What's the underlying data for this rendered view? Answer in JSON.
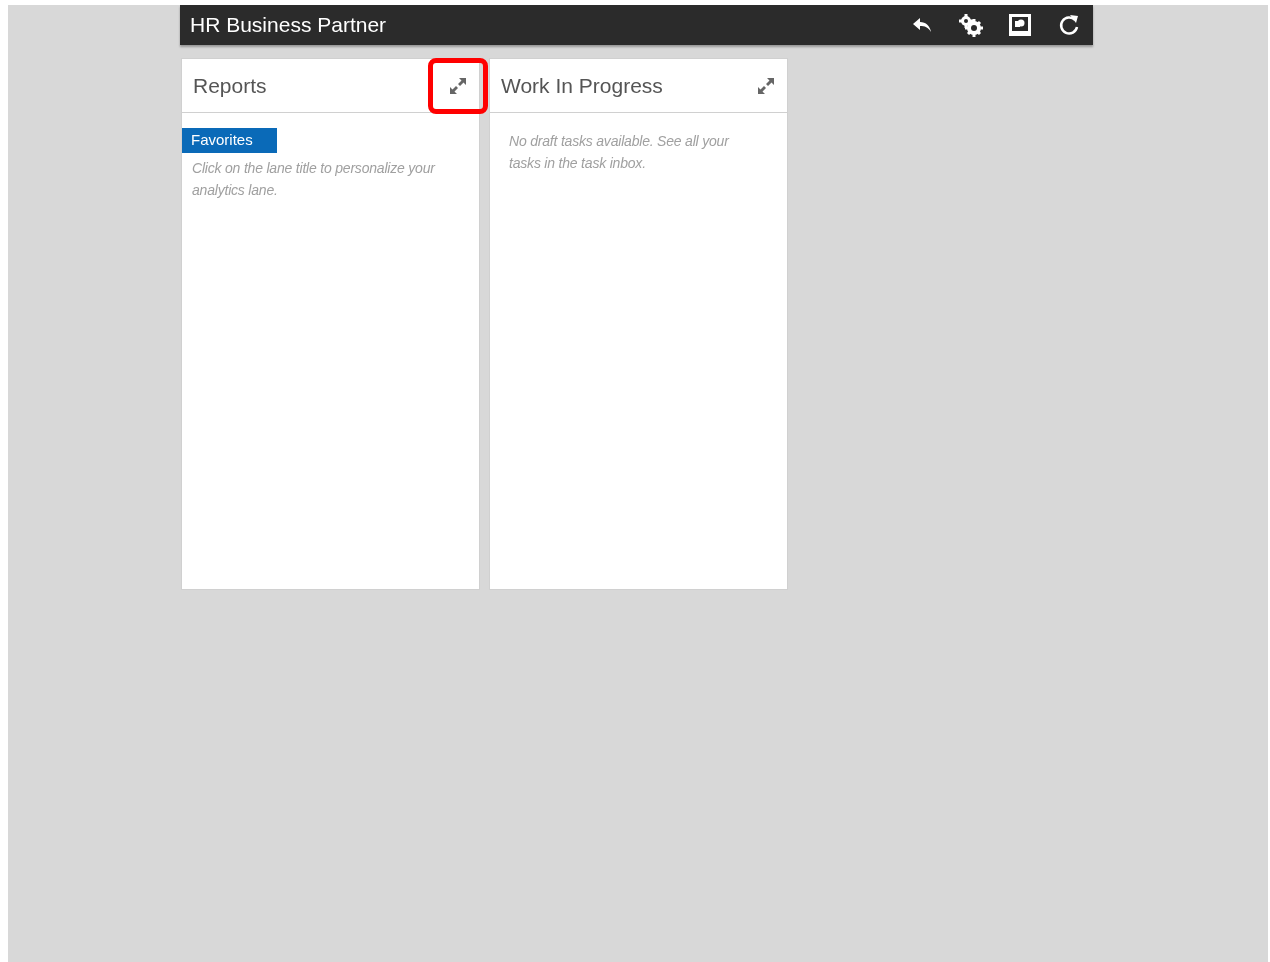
{
  "header": {
    "title": "HR Business Partner",
    "actions": [
      {
        "kind": "back"
      },
      {
        "kind": "settings"
      },
      {
        "kind": "picture"
      },
      {
        "kind": "refresh"
      }
    ]
  },
  "lanes": [
    {
      "title": "Reports",
      "expand_highlighted": true,
      "tag": "Favorites",
      "message": "Click on the lane title to personalize your analytics lane."
    },
    {
      "title": "Work In Progress",
      "expand_highlighted": false,
      "message": "No draft tasks available. See all your tasks in the task inbox."
    }
  ]
}
